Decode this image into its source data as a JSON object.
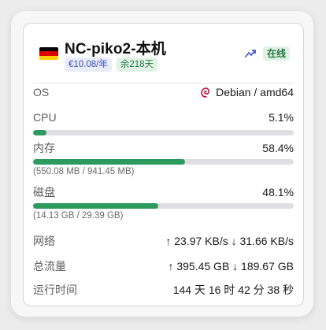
{
  "server": {
    "name": "NC-piko2-本机",
    "price": "€10.08/年",
    "remaining": "余218天",
    "status": "在线"
  },
  "os": {
    "label": "OS",
    "value": "Debian / amd64",
    "icon": "debian-swirl-icon"
  },
  "cpu": {
    "label": "CPU",
    "percent_text": "5.1%",
    "percent": 5.1
  },
  "memory": {
    "label": "内存",
    "percent_text": "58.4%",
    "percent": 58.4,
    "detail": "(550.08 MB / 941.45 MB)"
  },
  "disk": {
    "label": "磁盘",
    "percent_text": "48.1%",
    "percent": 48.1,
    "detail": "(14.13 GB / 29.39 GB)"
  },
  "network": {
    "label": "网络",
    "value": "↑ 23.97 KB/s ↓ 31.66 KB/s"
  },
  "traffic": {
    "label": "总流量",
    "value": "↑ 395.45 GB ↓ 189.67 GB"
  },
  "uptime": {
    "label": "运行时间",
    "value": "144 天 16 时 42 分 38 秒"
  },
  "colors": {
    "bar_fill": "#2d9a5e",
    "bar_track": "#dfdfe3",
    "online_bg": "#e3f2e7",
    "online_text": "#237a44",
    "price_bg": "#e9ecfb",
    "price_text": "#3f4fb3"
  },
  "flag": {
    "country": "Germany",
    "stripes": [
      "#000000",
      "#dd0000",
      "#ffce00"
    ]
  }
}
